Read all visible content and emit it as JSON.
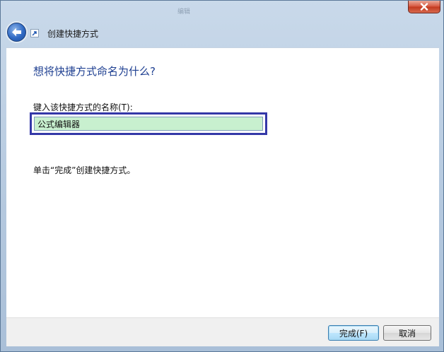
{
  "window": {
    "title": "创建快捷方式",
    "background_title": "编辑"
  },
  "header": {
    "title": "创建快捷方式"
  },
  "content": {
    "question": "想将快捷方式命名为什么?",
    "field_label": "键入该快捷方式的名称(T):",
    "name_value": "公式编辑器",
    "hint": "单击“完成”创建快捷方式。"
  },
  "footer": {
    "finish_label": "完成(F)",
    "cancel_label": "取消"
  },
  "colors": {
    "question_text": "#1e3f91",
    "input_highlight": "#3438a8",
    "input_background": "#c8f0cf",
    "close_button": "#c1391f"
  }
}
